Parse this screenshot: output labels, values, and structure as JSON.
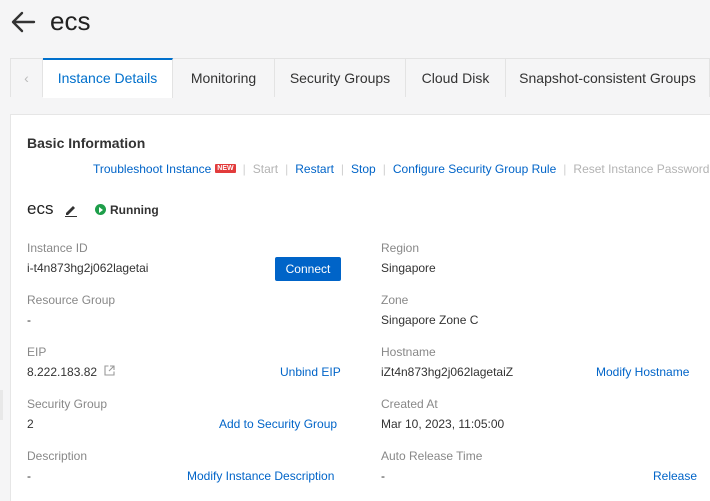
{
  "header": {
    "title": "ecs"
  },
  "tabs": [
    {
      "label": "Instance Details",
      "active": true
    },
    {
      "label": "Monitoring"
    },
    {
      "label": "Security Groups"
    },
    {
      "label": "Cloud Disk"
    },
    {
      "label": "Snapshot-consistent Groups"
    }
  ],
  "tab_prev": "‹",
  "basic": {
    "title": "Basic Information",
    "actions": {
      "troubleshoot": "Troubleshoot Instance",
      "new_badge": "NEW",
      "start": "Start",
      "restart": "Restart",
      "stop": "Stop",
      "configure_sg_rule": "Configure Security Group Rule",
      "reset_password": "Reset Instance Password"
    },
    "instance_name": "ecs",
    "status": "Running",
    "fields": {
      "instance_id": {
        "label": "Instance ID",
        "value": "i-t4n873hg2j062lagetai",
        "action": "Connect"
      },
      "region": {
        "label": "Region",
        "value": "Singapore"
      },
      "resource_group": {
        "label": "Resource Group",
        "value": "-"
      },
      "zone": {
        "label": "Zone",
        "value": "Singapore Zone C"
      },
      "eip": {
        "label": "EIP",
        "value": "8.222.183.82",
        "action": "Unbind EIP"
      },
      "hostname": {
        "label": "Hostname",
        "value": "iZt4n873hg2j062lagetaiZ",
        "action": "Modify Hostname"
      },
      "security_group": {
        "label": "Security Group",
        "value": "2",
        "action": "Add to Security Group"
      },
      "created_at": {
        "label": "Created At",
        "value": "Mar 10, 2023, 11:05:00"
      },
      "description": {
        "label": "Description",
        "value": "-",
        "action": "Modify Instance Description"
      },
      "auto_release": {
        "label": "Auto Release Time",
        "value": "-",
        "action": "Release"
      }
    }
  },
  "colors": {
    "link": "#0064c8",
    "primary_button": "#0064c8",
    "running": "#1e9e4a",
    "new_badge": "#e23b3b"
  }
}
